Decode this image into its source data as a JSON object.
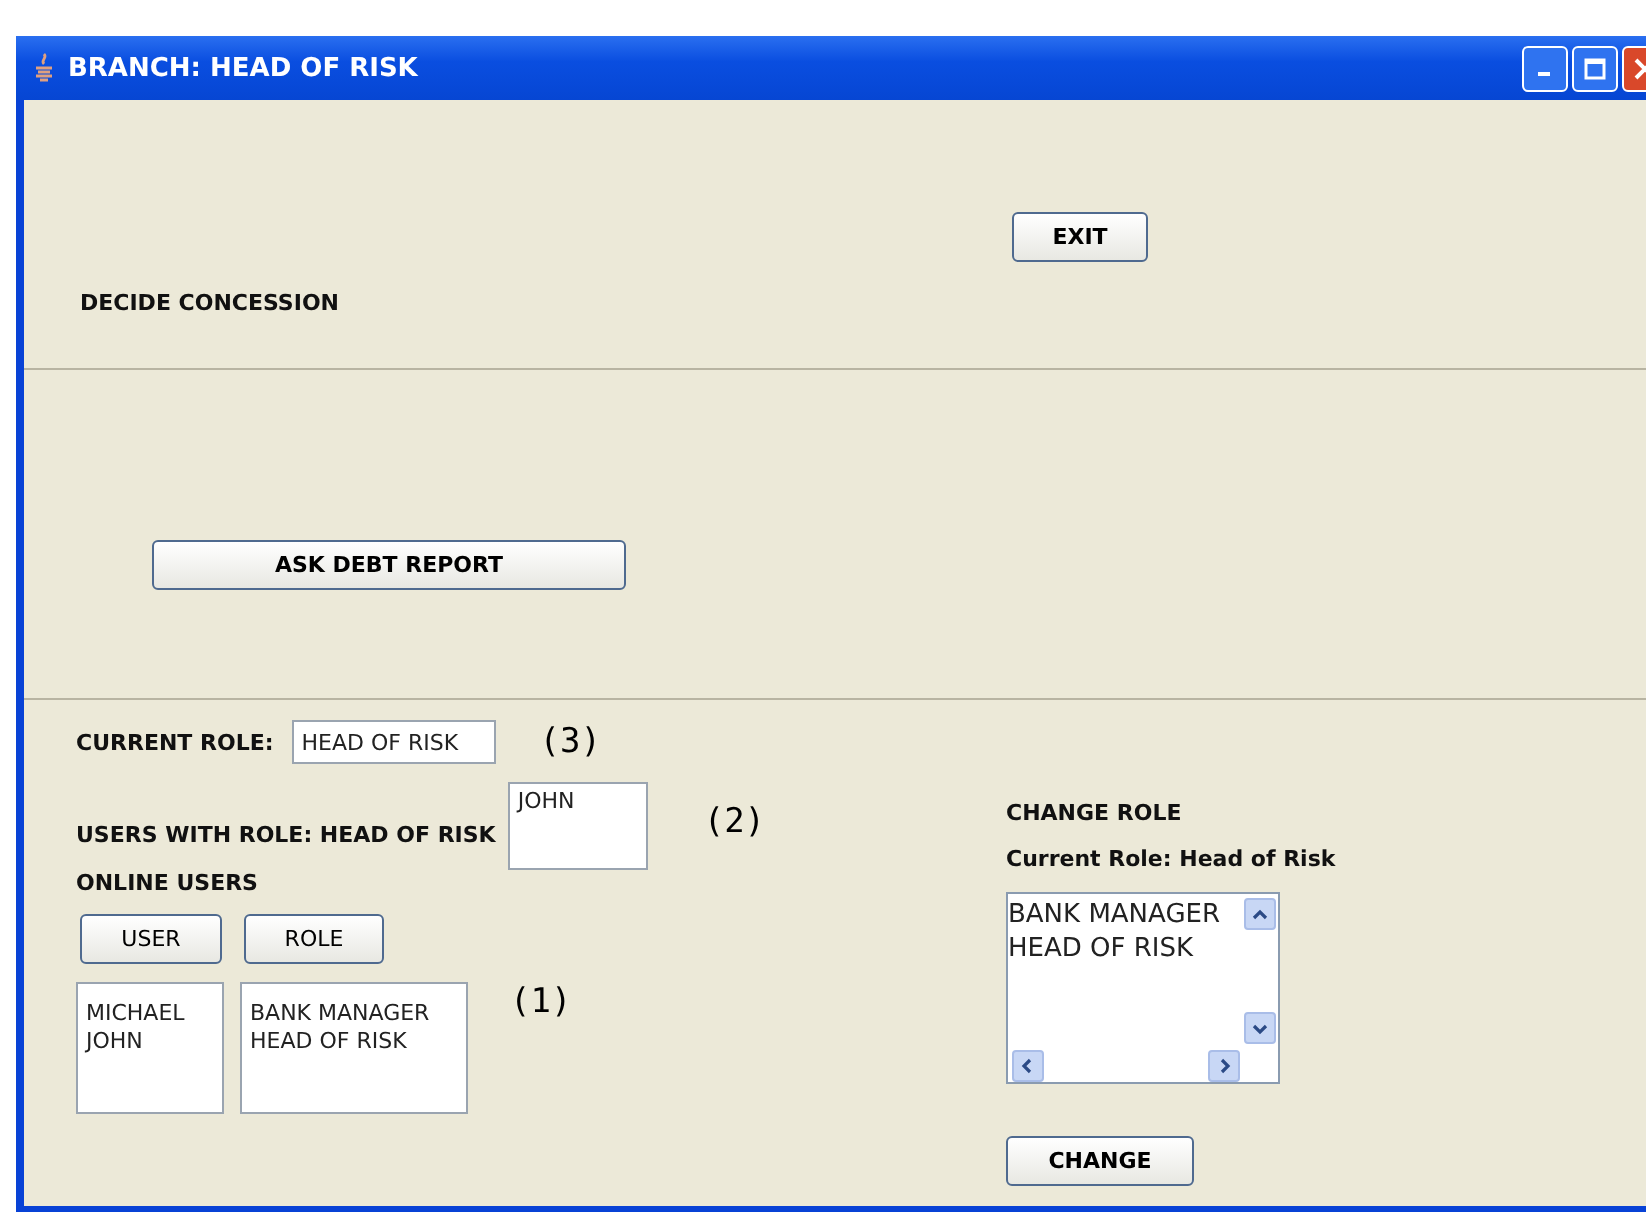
{
  "window": {
    "title": "BRANCH: HEAD OF RISK"
  },
  "top_section": {
    "exit_button": "EXIT",
    "label": "DECIDE CONCESSION"
  },
  "middle_section": {
    "ask_button": "ASK DEBT REPORT"
  },
  "roles_section": {
    "current_role_label": "CURRENT ROLE:",
    "current_role_value": "HEAD OF RISK",
    "marker_3": "(3)",
    "users_with_role_label": "USERS WITH ROLE: HEAD OF RISK",
    "users_with_role_value": "JOHN",
    "marker_2": "(2)",
    "online_users_label": "ONLINE USERS",
    "user_button": "USER",
    "role_button": "ROLE",
    "users_list": [
      "MICHAEL",
      "JOHN"
    ],
    "roles_list": [
      "BANK MANAGER",
      "HEAD OF RISK"
    ],
    "marker_1": "(1)"
  },
  "change_role": {
    "title": "CHANGE ROLE",
    "current": "Current Role: Head of Risk",
    "options": [
      "BANK MANAGER",
      "HEAD OF RISK"
    ],
    "button": "CHANGE"
  }
}
